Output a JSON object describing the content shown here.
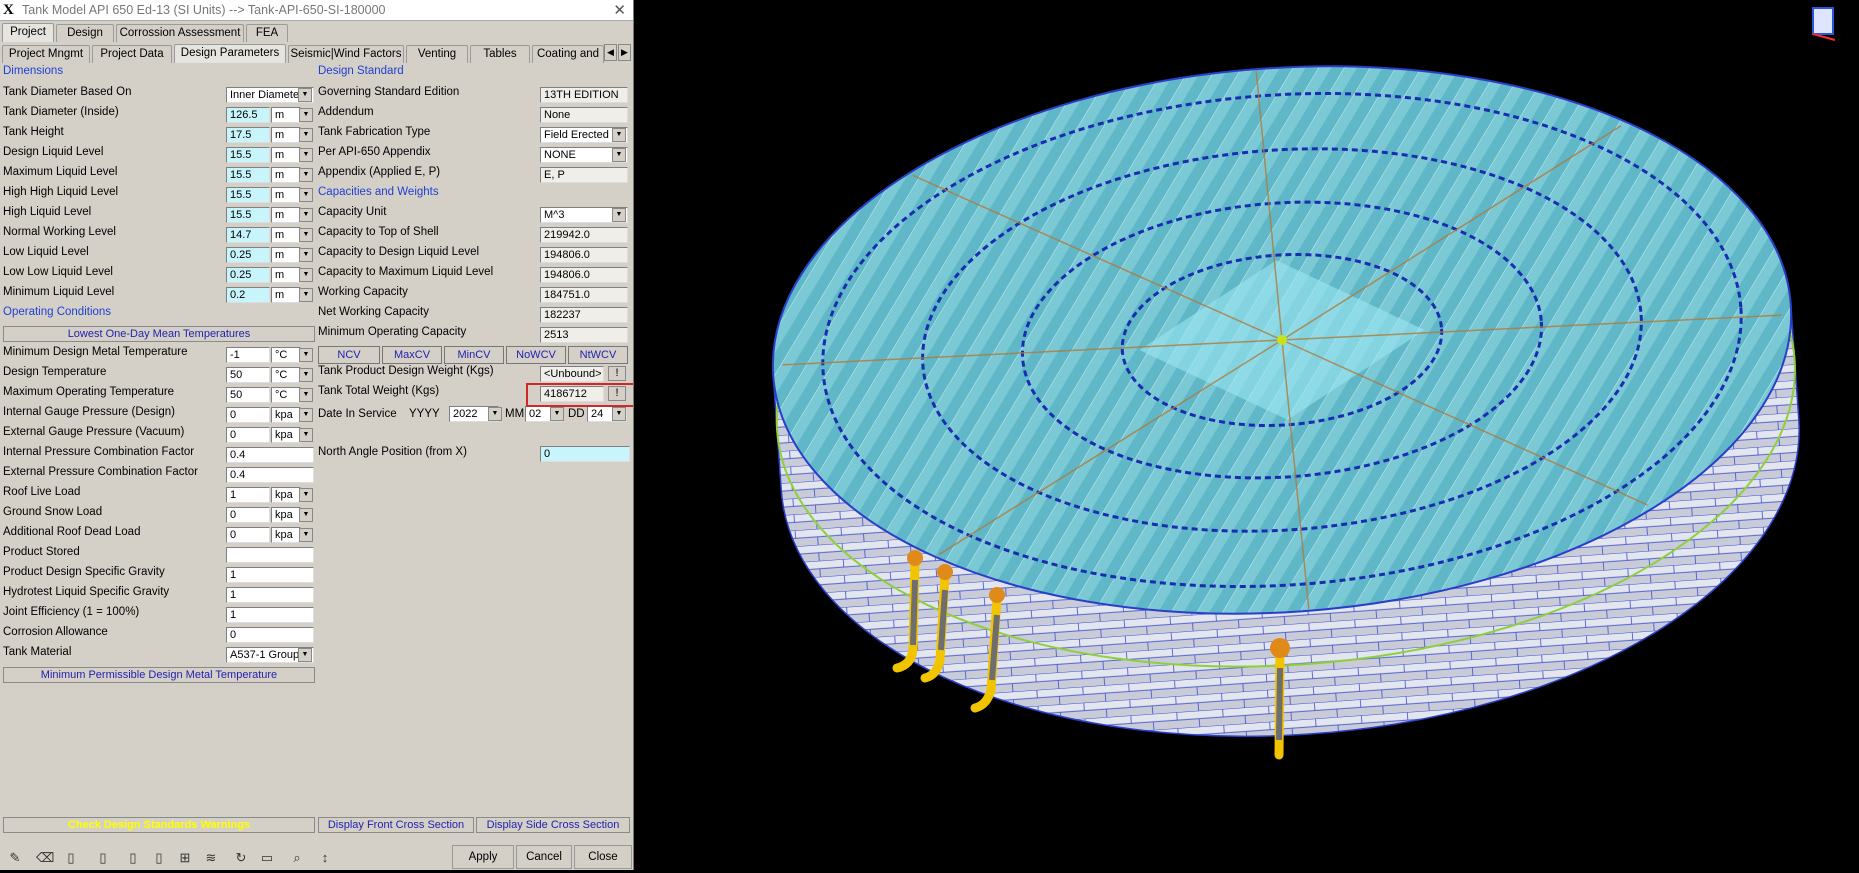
{
  "window": {
    "title": "Tank Model API 650 Ed-13 (SI Units) --> Tank-API-650-SI-180000",
    "close": "✕"
  },
  "main_tabs": [
    "Project",
    "Design",
    "Corrossion Assessment",
    "FEA"
  ],
  "sub_tabs": [
    "Project Mngmt",
    "Project Data",
    "Design Parameters",
    "Seismic|Wind Factors",
    "Venting",
    "Tables",
    "Coating and"
  ],
  "left": {
    "dimensions_header": "Dimensions",
    "dims": [
      {
        "label": "Tank Diameter Based On",
        "value": "Inner Diamete",
        "unit": ""
      },
      {
        "label": "Tank Diameter (Inside)",
        "value": "126.5",
        "unit": "m"
      },
      {
        "label": "Tank Height",
        "value": "17.5",
        "unit": "m"
      },
      {
        "label": "Design Liquid Level",
        "value": "15.5",
        "unit": "m"
      },
      {
        "label": "Maximum Liquid Level",
        "value": "15.5",
        "unit": "m"
      },
      {
        "label": "High High Liquid Level",
        "value": "15.5",
        "unit": "m"
      },
      {
        "label": "High Liquid Level",
        "value": "15.5",
        "unit": "m"
      },
      {
        "label": "Normal Working Level",
        "value": "14.7",
        "unit": "m"
      },
      {
        "label": "Low Liquid Level",
        "value": "0.25",
        "unit": "m"
      },
      {
        "label": "Low Low Liquid Level",
        "value": "0.25",
        "unit": "m"
      },
      {
        "label": "Minimum Liquid Level",
        "value": "0.2",
        "unit": "m"
      }
    ],
    "operating_header": "Operating Conditions",
    "lowest_bar": "Lowest One-Day Mean Temperatures",
    "ops": [
      {
        "label": "Minimum Design Metal Temperature",
        "value": "-1",
        "unit": "°C"
      },
      {
        "label": "Design Temperature",
        "value": "50",
        "unit": "°C"
      },
      {
        "label": "Maximum Operating Temperature",
        "value": "50",
        "unit": "°C"
      },
      {
        "label": "Internal Gauge Pressure (Design)",
        "value": "0",
        "unit": "kpa"
      },
      {
        "label": "External Gauge Pressure (Vacuum)",
        "value": "0",
        "unit": "kpa"
      },
      {
        "label": "Internal Pressure Combination Factor",
        "value": "0.4",
        "unit": ""
      },
      {
        "label": "External Pressure Combination Factor",
        "value": "0.4",
        "unit": ""
      },
      {
        "label": "Roof Live Load",
        "value": "1",
        "unit": "kpa"
      },
      {
        "label": "Ground Snow Load",
        "value": "0",
        "unit": "kpa"
      },
      {
        "label": "Additional Roof Dead Load",
        "value": "0",
        "unit": "kpa"
      },
      {
        "label": "Product Stored",
        "value": "",
        "unit": ""
      },
      {
        "label": "Product Design Specific Gravity",
        "value": "1",
        "unit": ""
      },
      {
        "label": "Hydrotest Liquid Specific Gravity",
        "value": "1",
        "unit": ""
      },
      {
        "label": "Joint Efficiency (1 = 100%)",
        "value": "1",
        "unit": ""
      },
      {
        "label": "Corrosion Allowance",
        "value": "0",
        "unit": ""
      },
      {
        "label": "Tank Material",
        "value": "A537-1 Group",
        "unit": ""
      }
    ],
    "mpdmt_bar": "Minimum Permissible Design Metal Temperature"
  },
  "right": {
    "design_std_header": "Design Standard",
    "std": [
      {
        "label": "Governing Standard Edition",
        "value": "13TH EDITION"
      },
      {
        "label": "Addendum",
        "value": "None"
      },
      {
        "label": "Tank Fabrication Type",
        "value": "Field Erected"
      },
      {
        "label": "Per API-650 Appendix",
        "value": "NONE"
      },
      {
        "label": "Appendix (Applied E, P)",
        "value": "E, P"
      }
    ],
    "cap_header": "Capacities and Weights",
    "caps": [
      {
        "label": "Capacity Unit",
        "value": "M^3"
      },
      {
        "label": "Capacity to Top of Shell",
        "value": "219942.0"
      },
      {
        "label": "Capacity to Design Liquid Level",
        "value": "194806.0"
      },
      {
        "label": "Capacity to Maximum Liquid Level",
        "value": "194806.0"
      },
      {
        "label": "Working Capacity",
        "value": "184751.0"
      },
      {
        "label": "Net Working Capacity",
        "value": "182237"
      },
      {
        "label": "Minimum Operating Capacity",
        "value": "2513"
      }
    ],
    "cv_buttons": [
      "NCV",
      "MaxCV",
      "MinCV",
      "NoWCV",
      "NtWCV"
    ],
    "product_weight": {
      "label": "Tank Product Design Weight (Kgs)",
      "value": "<Unbound>"
    },
    "total_weight": {
      "label": "Tank Total Weight (Kgs)",
      "value": "4186712"
    },
    "bang": "!",
    "date": {
      "label": "Date In Service",
      "yyyy_label": "YYYY",
      "yyyy": "2022",
      "mm_label": "MM",
      "mm": "02",
      "dd_label": "DD",
      "dd": "24"
    },
    "north": {
      "label": "North Angle Position (from X)",
      "value": "0"
    }
  },
  "bottom": {
    "warnings": "Check Design Standards Warnings",
    "front": "Display Front Cross Section",
    "side": "Display Side Cross Section"
  },
  "actions": {
    "apply": "Apply",
    "cancel": "Cancel",
    "close": "Close"
  },
  "toolbar_icons": [
    "pencil-icon",
    "eraser-icon",
    "book-icon",
    "book-icon",
    "book-icon",
    "book-icon",
    "table-icon",
    "layers-icon",
    "refresh-icon",
    "form-icon",
    "zoom-icon",
    "vertical-arrows-icon"
  ],
  "colors": {
    "warning_text": "#ffff00",
    "header_blue": "#1f3fd2",
    "cyan_field": "#c8f4fb",
    "highlight_red": "#d02828"
  }
}
